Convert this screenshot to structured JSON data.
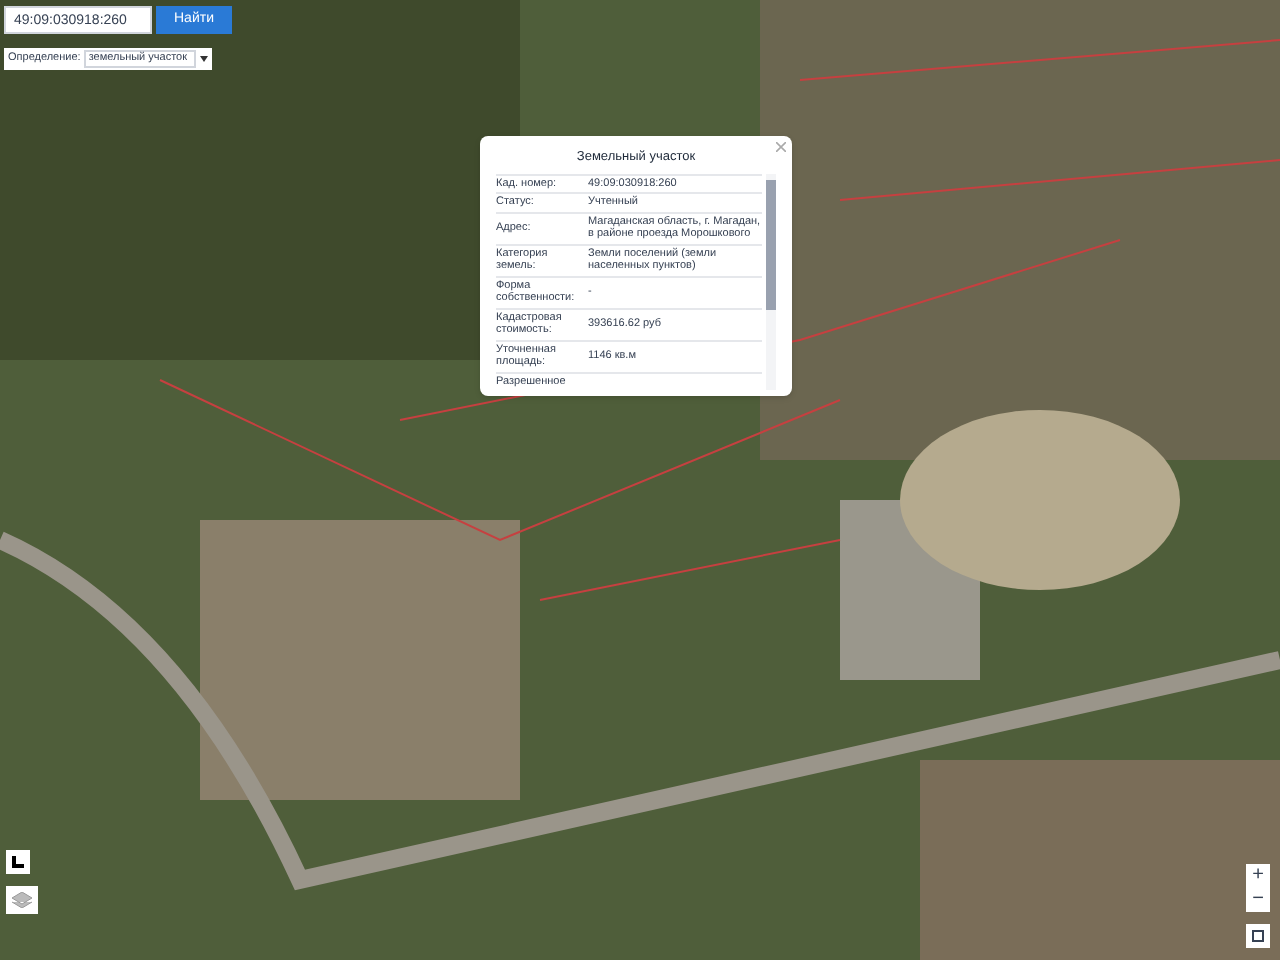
{
  "search": {
    "value": "49:09:030918:260",
    "button": "Найти"
  },
  "mode": {
    "label": "Определение:",
    "value": "земельный участок"
  },
  "popup": {
    "title": "Земельный участок",
    "rows": [
      {
        "label": "Кад. номер:",
        "value": "49:09:030918:260"
      },
      {
        "label": "Статус:",
        "value": "Учтенный"
      },
      {
        "label": "Адрес:",
        "value": "Магаданская область, г. Магадан, в районе проезда Морошкового"
      },
      {
        "label": "Категория земель:",
        "value": "Земли поселений (земли населенных пунктов)"
      },
      {
        "label": "Форма собственности:",
        "value": "-"
      },
      {
        "label": "Кадастровая стоимость:",
        "value": "393616.62 руб"
      },
      {
        "label": "Уточненная площадь:",
        "value": "1146 кв.м"
      },
      {
        "label": "Разрешенное"
      }
    ]
  },
  "zoom": {
    "in": "+",
    "out": "−"
  }
}
